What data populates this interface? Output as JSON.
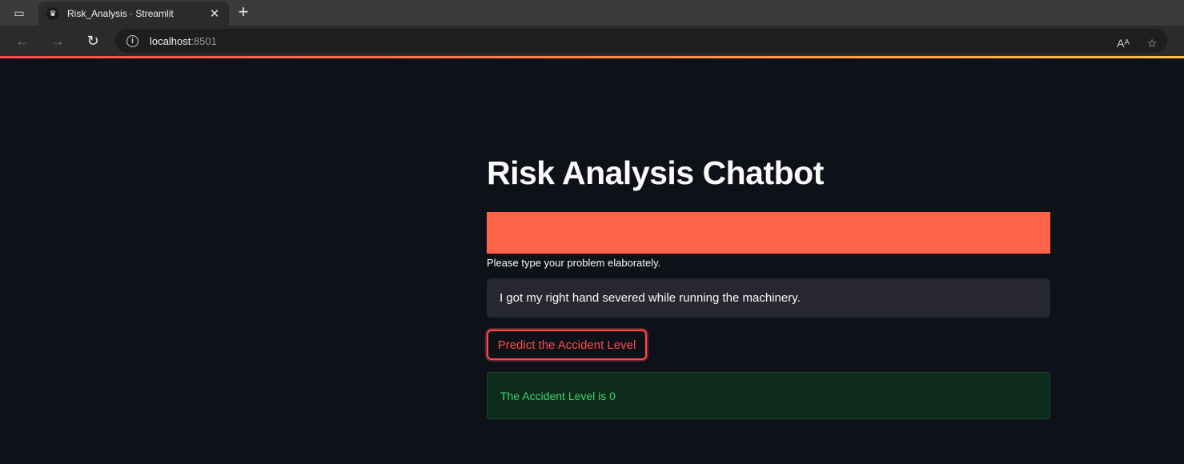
{
  "browser": {
    "tab_title": "Risk_Analysis · Streamlit",
    "url_host": "localhost",
    "url_port": ":8501",
    "icons": [
      "tab-actions-icon",
      "favicon-icon",
      "close-icon",
      "plus-icon",
      "back-icon",
      "forward-icon",
      "refresh-icon",
      "info-icon",
      "read-aloud-icon",
      "add-favorite-icon"
    ]
  },
  "app": {
    "title": "Risk Analysis Chatbot",
    "banner_color": "#ff6347",
    "input_label": "Please type your problem elaborately.",
    "input_value": "I got my right hand severed while running the machinery.",
    "predict_button_label": "Predict the Accident Level",
    "result_text": "The Accident Level is 0"
  },
  "colors": {
    "background": "#0e1117",
    "accent": "#ff4b4b",
    "success_text": "#3dd56d",
    "success_bg": "#0d2b1c"
  }
}
